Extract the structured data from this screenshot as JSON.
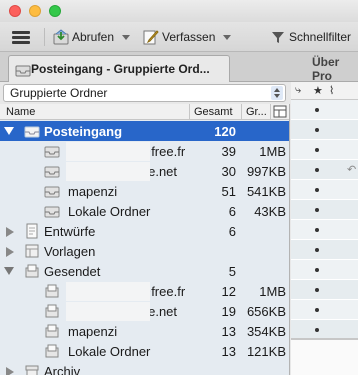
{
  "toolbar": {
    "get_mail_label": "Abrufen",
    "write_label": "Verfassen",
    "filter_label": "Schnellfilter"
  },
  "tabs": {
    "active_label": "Posteingang - Gruppierte Ord...",
    "inactive_label": "Über Pro"
  },
  "folder_mode": {
    "selected": "Gruppierte Ordner"
  },
  "columns": {
    "name": "Name",
    "total": "Gesamt",
    "size": "Gr..."
  },
  "folders": [
    {
      "name": "Posteingang",
      "count": "120",
      "size": ""
    },
    {
      "name": "@free.fr",
      "count": "39",
      "size": "1MB"
    },
    {
      "name": "ste.net",
      "count": "30",
      "size": "997KB"
    },
    {
      "name": "mapenzi",
      "count": "51",
      "size": "541KB"
    },
    {
      "name": "Lokale Ordner",
      "count": "6",
      "size": "43KB"
    },
    {
      "name": "Entwürfe",
      "count": "6",
      "size": ""
    },
    {
      "name": "Vorlagen",
      "count": "",
      "size": ""
    },
    {
      "name": "Gesendet",
      "count": "5",
      "size": ""
    },
    {
      "name": "@free.fr",
      "count": "12",
      "size": "1MB"
    },
    {
      "name": "ste.net",
      "count": "19",
      "size": "656KB"
    },
    {
      "name": "mapenzi",
      "count": "13",
      "size": "354KB"
    },
    {
      "name": "Lokale Ordner",
      "count": "13",
      "size": "121KB"
    },
    {
      "name": "Archiv",
      "count": "",
      "size": ""
    }
  ],
  "colors": {
    "selection": "#2866c9",
    "pane_bg": "#e5ebf1"
  }
}
